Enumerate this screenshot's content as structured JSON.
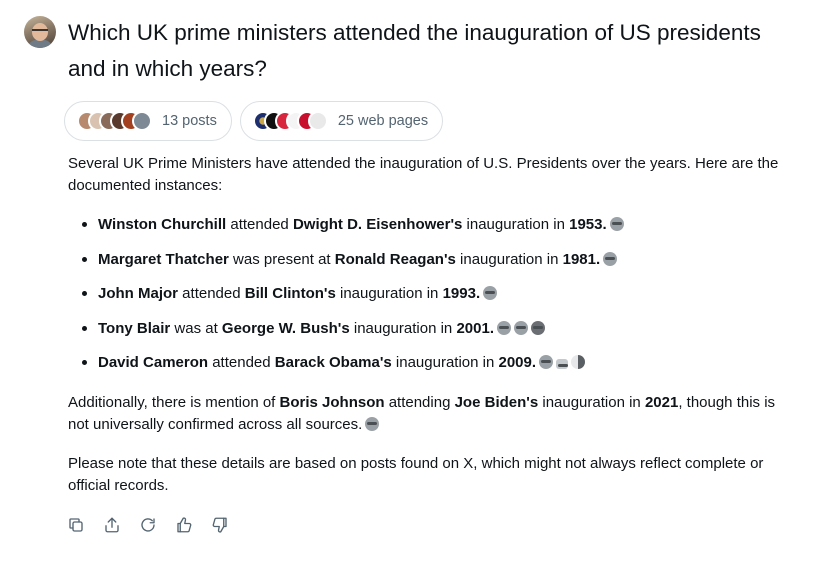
{
  "question": "Which UK prime ministers attended the inauguration of US presidents and in which years?",
  "sources": {
    "posts_label": "13 posts",
    "web_label": "25 web pages"
  },
  "answer": {
    "intro": "Several UK Prime Ministers have attended the inauguration of U.S. Presidents over the years. Here are the documented instances:",
    "items": [
      {
        "pm": "Winston Churchill",
        "verb": " attended ",
        "president": "Dwight D. Eisenhower's",
        "mid": " inauguration in ",
        "year": "1953"
      },
      {
        "pm": "Margaret Thatcher",
        "verb": " was present at ",
        "president": "Ronald Reagan's",
        "mid": " inauguration in ",
        "year": "1981"
      },
      {
        "pm": "John Major",
        "verb": " attended ",
        "president": "Bill Clinton's",
        "mid": " inauguration in ",
        "year": "1993"
      },
      {
        "pm": "Tony Blair",
        "verb": " was at ",
        "president": "George W. Bush's",
        "mid": " inauguration in ",
        "year": "2001"
      },
      {
        "pm": "David Cameron",
        "verb": " attended ",
        "president": "Barack Obama's",
        "mid": " inauguration in ",
        "year": "2009"
      }
    ],
    "additional": {
      "pre": "Additionally, there is mention of ",
      "pm": "Boris Johnson",
      "mid": " attending ",
      "president": "Joe Biden's",
      "mid2": " inauguration in ",
      "year": "2021",
      "post": ", though this is not universally confirmed across all sources."
    },
    "note": "Please note that these details are based on posts found on X, which might not always reflect complete or official records."
  },
  "actions": [
    "copy-icon",
    "share-icon",
    "regenerate-icon",
    "thumbs-up-icon",
    "thumbs-down-icon"
  ],
  "colors": {
    "text": "#0f1419",
    "muted": "#536471",
    "border": "#dbe0e4"
  }
}
